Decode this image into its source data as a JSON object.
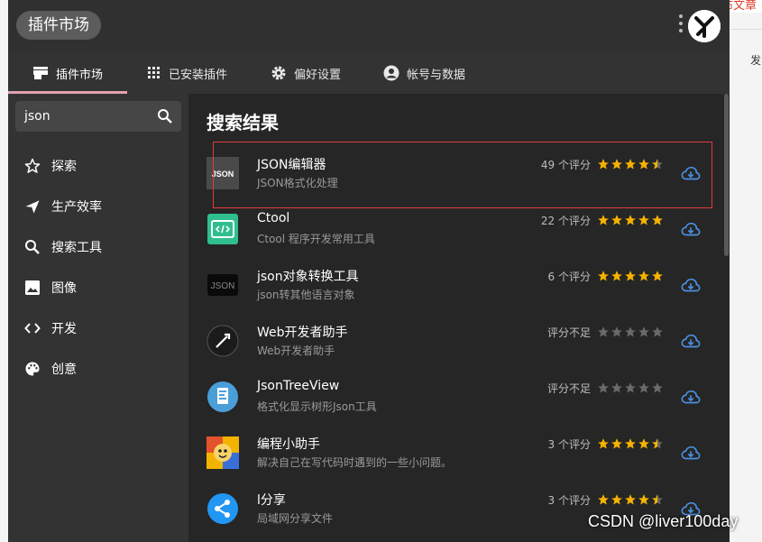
{
  "background": {
    "corner_text": "布文章",
    "side_text": "发"
  },
  "header": {
    "title": "插件市场"
  },
  "tabs": [
    {
      "label": "插件市场",
      "icon": "store-icon",
      "active": true
    },
    {
      "label": "已安装插件",
      "icon": "apps-grid-icon",
      "active": false
    },
    {
      "label": "偏好设置",
      "icon": "gear-icon",
      "active": false
    },
    {
      "label": "帐号与数据",
      "icon": "account-icon",
      "active": false
    }
  ],
  "search": {
    "value": "json"
  },
  "nav": [
    {
      "label": "探索",
      "icon": "star-outline-icon"
    },
    {
      "label": "生产效率",
      "icon": "send-icon"
    },
    {
      "label": "搜索工具",
      "icon": "search-icon"
    },
    {
      "label": "图像",
      "icon": "image-icon"
    },
    {
      "label": "开发",
      "icon": "code-icon"
    },
    {
      "label": "创意",
      "icon": "palette-icon"
    }
  ],
  "main": {
    "title": "搜索结果"
  },
  "results": [
    {
      "name": "JSON编辑器",
      "desc": "JSON格式化处理",
      "rating_text": "49 个评分",
      "stars": 4.5,
      "icon": "json-square-icon"
    },
    {
      "name": "Ctool",
      "desc": "Ctool 程序开发常用工具",
      "rating_text": "22 个评分",
      "stars": 5,
      "icon": "code-window-icon"
    },
    {
      "name": "json对象转换工具",
      "desc": "json转其他语言对象",
      "rating_text": "6 个评分",
      "stars": 5,
      "icon": "json-black-icon"
    },
    {
      "name": "Web开发者助手",
      "desc": "Web开发者助手",
      "rating_text": "评分不足",
      "stars": 0,
      "icon": "web-dev-icon"
    },
    {
      "name": "JsonTreeView",
      "desc": "格式化显示树形Json工具",
      "rating_text": "评分不足",
      "stars": 0,
      "icon": "json-tree-icon"
    },
    {
      "name": "编程小助手",
      "desc": "解决自己在写代码时遇到的一些小问题。",
      "rating_text": "3 个评分",
      "stars": 4.5,
      "icon": "cartoon-icon"
    },
    {
      "name": "l分享",
      "desc": "局域网分享文件",
      "rating_text": "3 个评分",
      "stars": 4.5,
      "icon": "share-icon"
    }
  ],
  "watermark": "CSDN @liver100day",
  "colors": {
    "star": "#f5b301",
    "star_empty": "#6a6a6a",
    "download": "#4a90e2",
    "highlight": "#e23b3b",
    "tab_underline": "#e2a2b0"
  }
}
